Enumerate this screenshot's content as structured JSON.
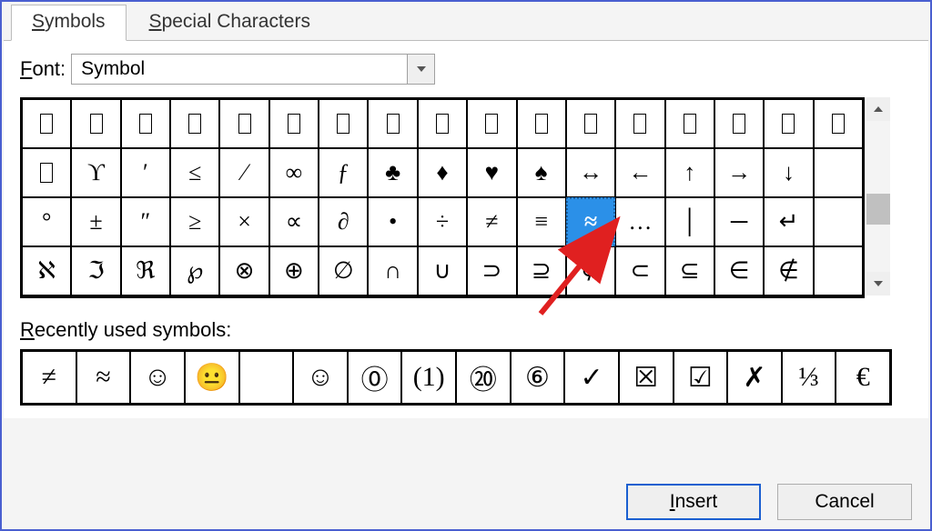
{
  "tabs": {
    "symbols": "Symbols",
    "special": "Special Characters"
  },
  "font": {
    "label": "Font:",
    "value": "Symbol"
  },
  "grid": {
    "cols": 17,
    "rows": [
      [
        "□",
        "□",
        "□",
        "□",
        "□",
        "□",
        "□",
        "□",
        "□",
        "□",
        "□",
        "□",
        "□",
        "□",
        "□",
        "□",
        "□"
      ],
      [
        "□",
        "ϒ",
        "′",
        "≤",
        "⁄",
        "∞",
        "ƒ",
        "♣",
        "♦",
        "♥",
        "♠",
        "↔",
        "←",
        "↑",
        "→",
        "↓",
        ""
      ],
      [
        "°",
        "±",
        "″",
        "≥",
        "×",
        "∝",
        "∂",
        "•",
        "÷",
        "≠",
        "≡",
        "≈",
        "…",
        "│",
        "─",
        "↵",
        ""
      ],
      [
        "ℵ",
        "ℑ",
        "ℜ",
        "℘",
        "⊗",
        "⊕",
        "∅",
        "∩",
        "∪",
        "⊃",
        "⊇",
        "⊄",
        "⊂",
        "⊆",
        "∈",
        "∉",
        ""
      ]
    ],
    "selected": {
      "row": 2,
      "col": 11
    }
  },
  "recent": {
    "label": "Recently used symbols:",
    "items": [
      "≠",
      "≈",
      "☺",
      "😐",
      "",
      "☺",
      "⓪",
      "(1)",
      "⑳",
      "⑥",
      "✓",
      "☒",
      "☑",
      "✗",
      "⅓",
      "€"
    ]
  },
  "buttons": {
    "insert": "Insert",
    "cancel": "Cancel"
  }
}
